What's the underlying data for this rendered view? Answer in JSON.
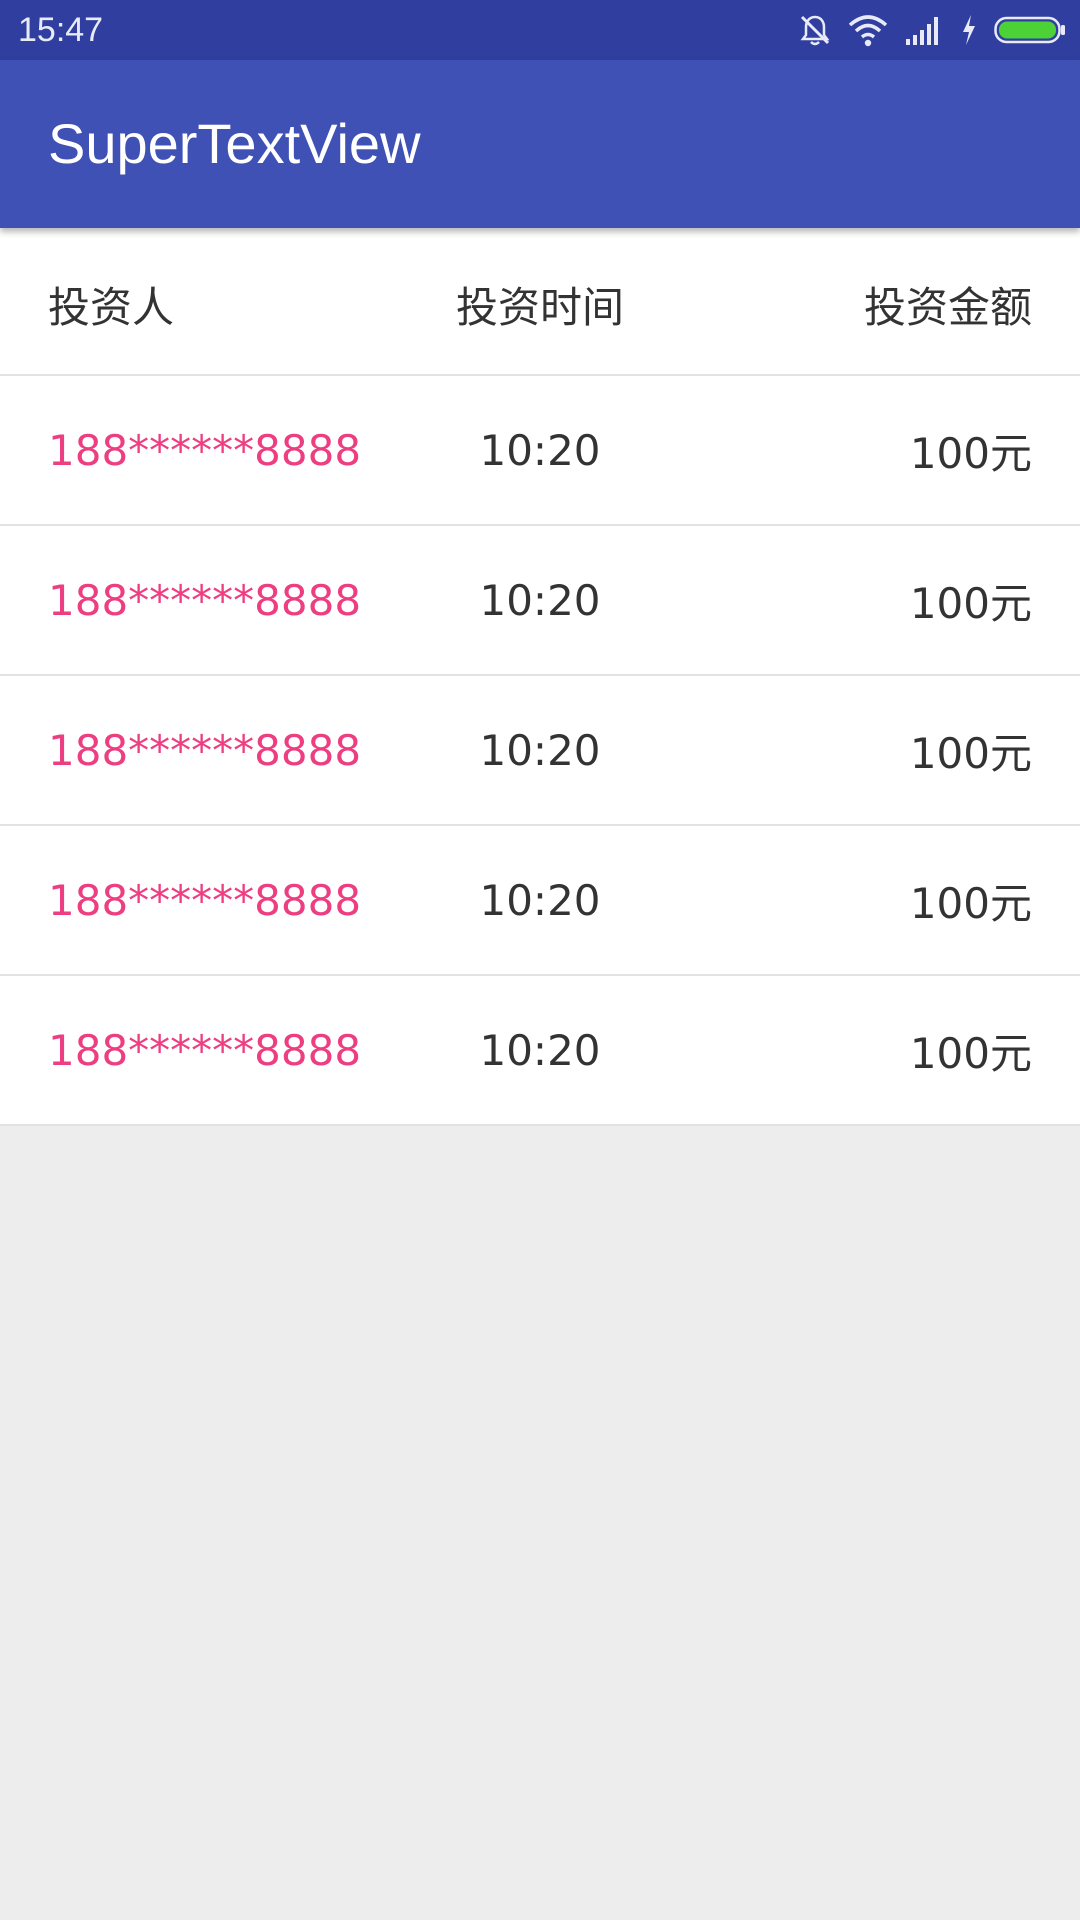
{
  "status_bar": {
    "time": "15:47",
    "icons": [
      "notifications-muted-icon",
      "wifi-icon",
      "signal-icon",
      "charging-icon",
      "battery-icon"
    ],
    "battery_color": "#4cd137"
  },
  "app_bar": {
    "title": "SuperTextView",
    "color": "#3f51b5"
  },
  "table": {
    "headers": [
      "投资人",
      "投资时间",
      "投资金额"
    ],
    "rows": [
      {
        "investor": "188******8888",
        "time": "10:20",
        "amount": "100元"
      },
      {
        "investor": "188******8888",
        "time": "10:20",
        "amount": "100元"
      },
      {
        "investor": "188******8888",
        "time": "10:20",
        "amount": "100元"
      },
      {
        "investor": "188******8888",
        "time": "10:20",
        "amount": "100元"
      },
      {
        "investor": "188******8888",
        "time": "10:20",
        "amount": "100元"
      }
    ],
    "accent_color": "#ee3e82"
  }
}
